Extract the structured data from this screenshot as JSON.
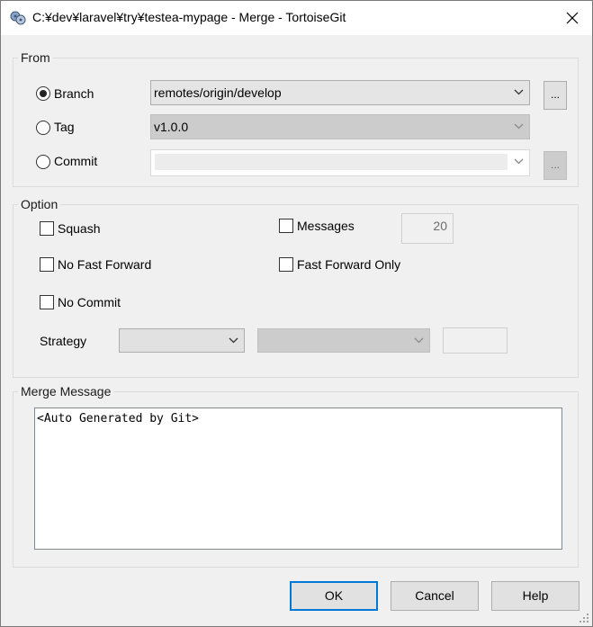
{
  "window": {
    "title": "C:¥dev¥laravel¥try¥testea-mypage - Merge - TortoiseGit"
  },
  "from": {
    "group_label": "From",
    "branch": {
      "label": "Branch",
      "selected": true,
      "value": "remotes/origin/develop",
      "browse_label": "..."
    },
    "tag": {
      "label": "Tag",
      "selected": false,
      "value": "v1.0.0"
    },
    "commit": {
      "label": "Commit",
      "selected": false,
      "value": "",
      "browse_label": "..."
    }
  },
  "option": {
    "group_label": "Option",
    "squash": {
      "label": "Squash",
      "checked": false
    },
    "messages": {
      "label": "Messages",
      "checked": false,
      "count": "20"
    },
    "no_fast_forward": {
      "label": "No Fast Forward",
      "checked": false
    },
    "fast_forward_only": {
      "label": "Fast Forward Only",
      "checked": false
    },
    "no_commit": {
      "label": "No Commit",
      "checked": false
    },
    "strategy": {
      "label": "Strategy",
      "value": "",
      "option_value": "",
      "param": ""
    }
  },
  "merge_message": {
    "group_label": "Merge Message",
    "text": "<Auto Generated by Git>"
  },
  "buttons": {
    "ok": "OK",
    "cancel": "Cancel",
    "help": "Help"
  }
}
